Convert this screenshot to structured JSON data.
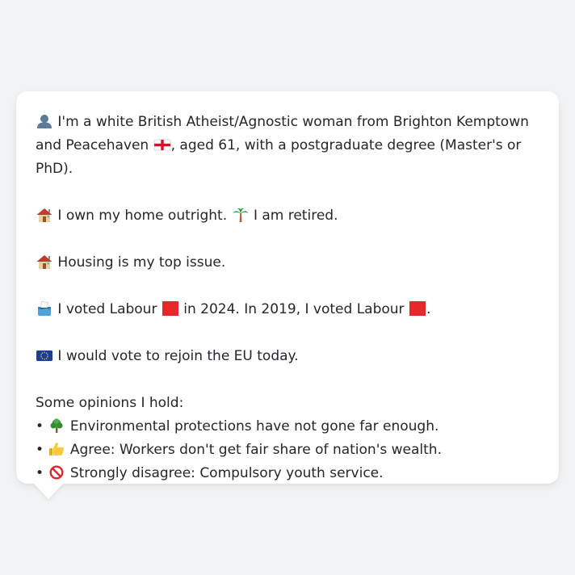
{
  "profile": {
    "identity": {
      "icon": "person-silhouette-icon",
      "text": "I'm a white British Atheist/Agnostic woman from Brighton Kemptown and Peacehaven",
      "flag_icon": "england-flag-icon",
      "tail": ", aged 61, with a postgraduate degree (Master's or PhD)."
    },
    "home": {
      "icon": "house-icon",
      "text": "I own my home outright.",
      "status_icon": "palm-tree-icon",
      "status_text": "I am retired."
    },
    "top_issue": {
      "icon": "house-icon",
      "text": "Housing is my top issue."
    },
    "vote": {
      "icon": "ballot-box-icon",
      "text_2024_a": "I voted Labour",
      "text_2024_b": "in 2024. In 2019, I voted Labour",
      "end": ".",
      "party_color": "#e8272b"
    },
    "eu": {
      "icon": "eu-flag-icon",
      "text": "I would vote to rejoin the EU today."
    },
    "opinions": {
      "heading": "Some opinions I hold:",
      "bullet": "•",
      "items": [
        {
          "icon": "tree-icon",
          "text": "Environmental protections have not gone far enough."
        },
        {
          "icon": "thumbs-up-icon",
          "text": "Agree: Workers don't get fair share of nation's wealth."
        },
        {
          "icon": "prohibited-icon",
          "text": "Strongly disagree: Compulsory youth service."
        }
      ]
    }
  },
  "colors": {
    "background": "#f2f3f5",
    "card": "#ffffff",
    "text": "#23262b",
    "labour_red": "#e8272b",
    "eu_blue": "#1c3f94"
  }
}
